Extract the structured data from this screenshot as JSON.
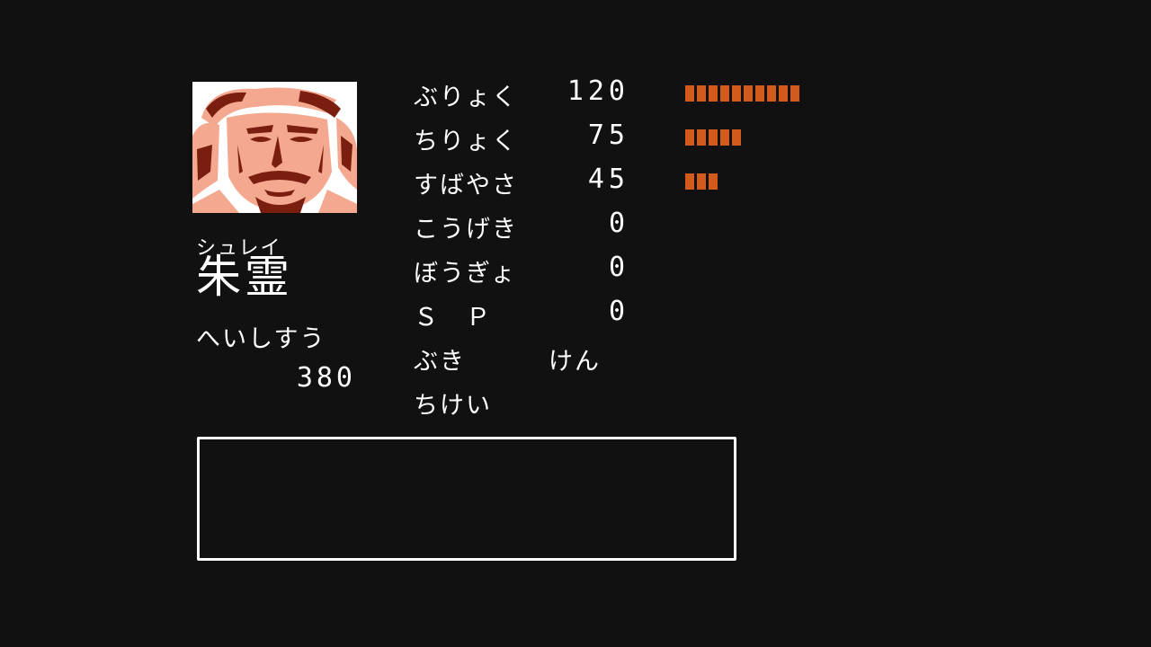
{
  "general": {
    "furigana": "シュレイ",
    "name": "朱霊",
    "portrait_icon": "general-portrait-icon"
  },
  "soldiers": {
    "label": "へいしすう",
    "value": "380"
  },
  "stats": {
    "power": {
      "label": "ぶりょく",
      "value": "120",
      "bar_level": 10
    },
    "intellect": {
      "label": "ちりょく",
      "value": "75",
      "bar_level": 5
    },
    "speed": {
      "label": "すばやさ",
      "value": "45",
      "bar_level": 3
    },
    "attack": {
      "label": "こうげき",
      "value": "0"
    },
    "defense": {
      "label": "ぼうぎょ",
      "value": "0"
    },
    "sp": {
      "label": "Ｓ　Ｐ",
      "value": "0"
    },
    "weapon": {
      "label": "ぶき",
      "value": "けん"
    },
    "terrain": {
      "label": "ちけい",
      "value": ""
    }
  },
  "message": {
    "text": ""
  },
  "colors": {
    "background": "#111111",
    "text": "#ffffff",
    "bar": "#d15a1c",
    "portrait_light": "#f4a890",
    "portrait_dark": "#7a1e10"
  }
}
